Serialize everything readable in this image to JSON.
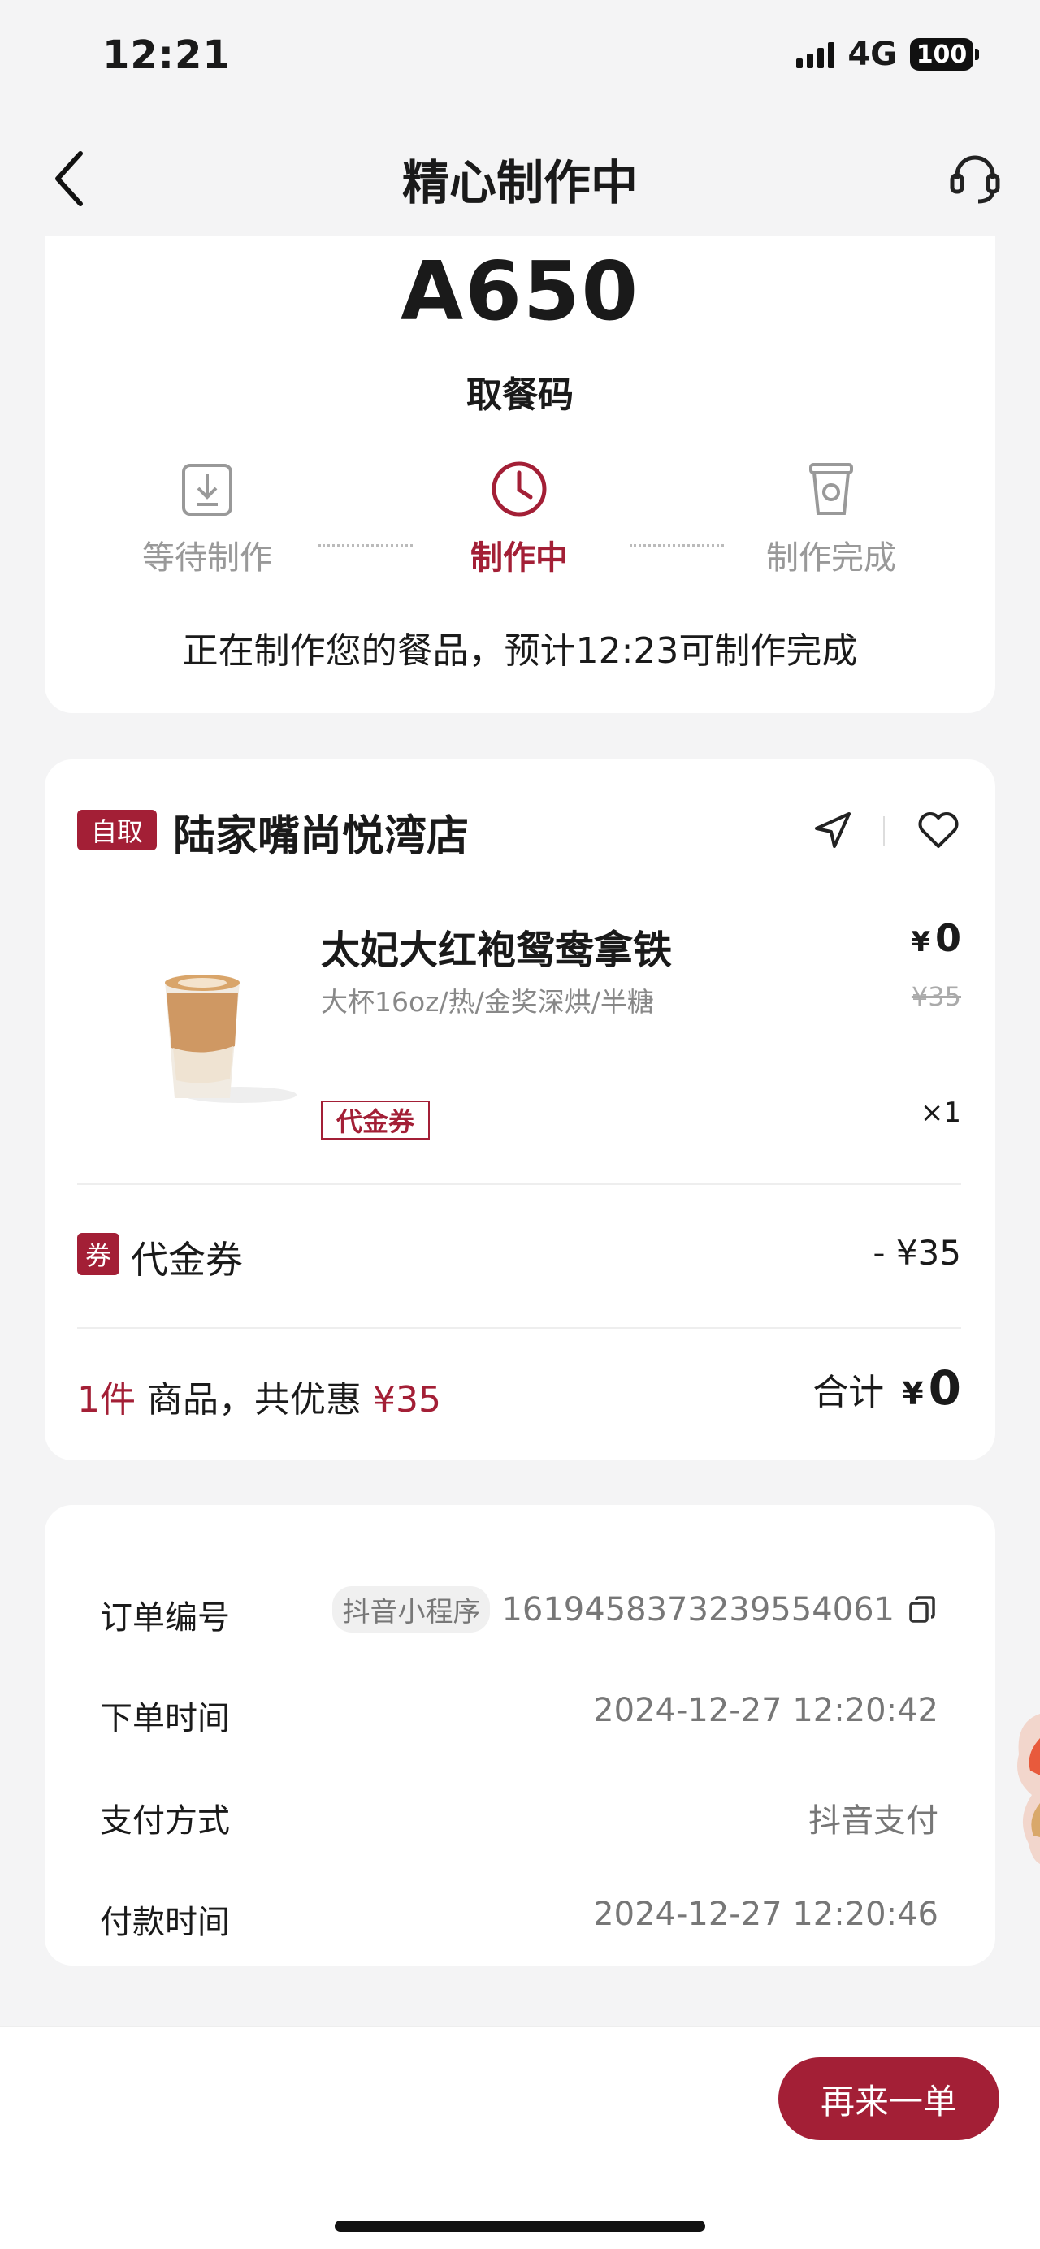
{
  "status_bar": {
    "time": "12:21",
    "network": "4G",
    "battery": "100"
  },
  "nav": {
    "title": "精心制作中"
  },
  "pickup": {
    "code": "A650",
    "code_label": "取餐码",
    "steps": [
      {
        "label": "等待制作",
        "active": false
      },
      {
        "label": "制作中",
        "active": true
      },
      {
        "label": "制作完成",
        "active": false
      }
    ],
    "progress_text": "正在制作您的餐品，预计12:23可制作完成"
  },
  "order": {
    "store_tag": "自取",
    "store_name": "陆家嘴尚悦湾店",
    "product": {
      "name": "太妃大红袍鸳鸯拿铁",
      "spec": "大杯16oz/热/金奖深烘/半糖",
      "currency": "¥",
      "price": "0",
      "original_price": "¥35",
      "badge": "代金券",
      "quantity": "×1"
    },
    "coupon": {
      "tag": "券",
      "label": "代金券",
      "amount": "- ¥35"
    },
    "summary": {
      "count": "1件",
      "text": " 商品，共优惠 ",
      "discount": "¥35",
      "total_label": "合计",
      "currency": "¥",
      "total": "0"
    }
  },
  "info": {
    "order_no_label": "订单编号",
    "order_source": "抖音小程序",
    "order_no": "1619458373239554061",
    "order_time_label": "下单时间",
    "order_time": "2024-12-27 12:20:42",
    "pay_method_label": "支付方式",
    "pay_method": "抖音支付",
    "pay_time_label": "付款时间",
    "pay_time": "2024-12-27 12:20:46"
  },
  "footer": {
    "reorder_label": "再来一单"
  },
  "colors": {
    "accent": "#a31f36",
    "background": "#f4f4f5"
  }
}
